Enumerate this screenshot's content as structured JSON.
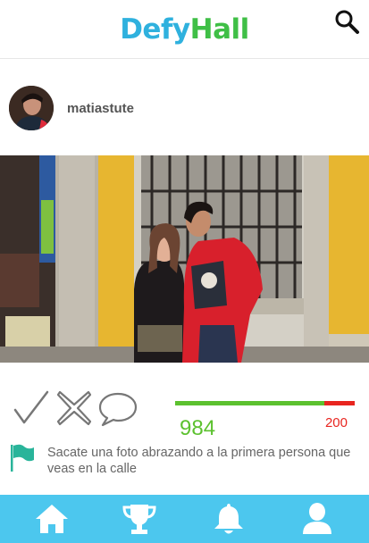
{
  "app": {
    "logo_part1": "Defy",
    "logo_part2": "Hall",
    "logo_colors": {
      "part1": "#2fb1de",
      "part2": "#3fbf46"
    },
    "header_right_icon": "search-icon"
  },
  "post": {
    "username": "matiastute",
    "avatar_icon": "avatar",
    "photo_description_icon": "post-photo",
    "actions": [
      {
        "name": "accept",
        "icon": "check-icon"
      },
      {
        "name": "reject",
        "icon": "cross-icon"
      },
      {
        "name": "comment",
        "icon": "speech-bubble-icon"
      }
    ],
    "votes": {
      "yes": "984",
      "no": "200",
      "yes_fraction": 0.831,
      "yes_color": "#5cc12f",
      "no_color": "#e8251f"
    },
    "challenge_icon": "flag-icon",
    "challenge_text": "Sacate una foto abrazando a la primera persona que veas en la calle"
  },
  "bottom_nav": {
    "background": "#4cc7ee",
    "items": [
      {
        "name": "home",
        "icon": "home-icon"
      },
      {
        "name": "trophy",
        "icon": "trophy-icon"
      },
      {
        "name": "notifications",
        "icon": "bell-icon"
      },
      {
        "name": "profile",
        "icon": "user-icon"
      }
    ]
  }
}
